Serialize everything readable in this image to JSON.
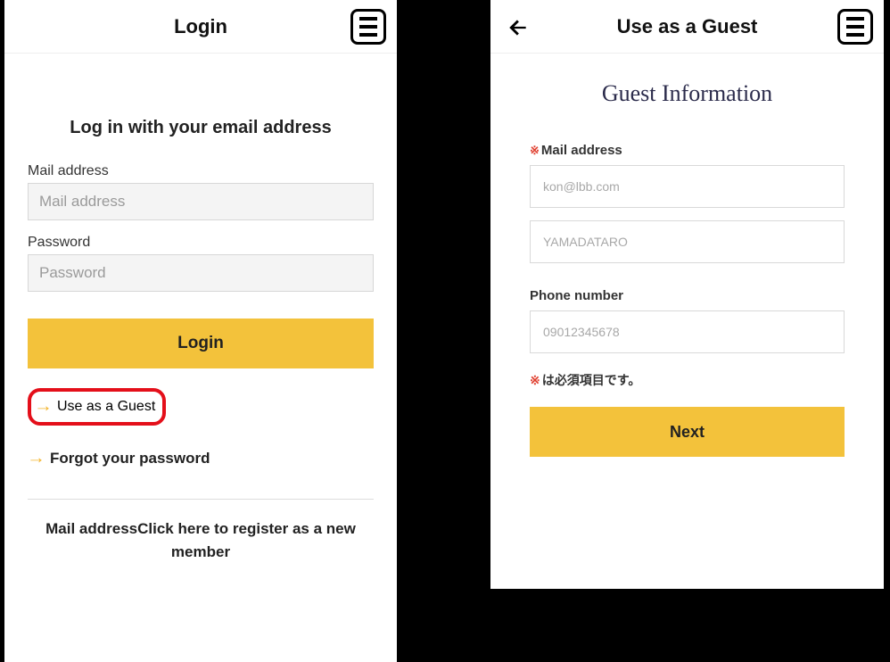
{
  "left": {
    "header_title": "Login",
    "heading": "Log in with your email address",
    "mail_label": "Mail address",
    "mail_placeholder": "Mail address",
    "password_label": "Password",
    "password_placeholder": "Password",
    "login_button": "Login",
    "guest_link": "Use as a Guest",
    "forgot_link": "Forgot your password",
    "register_text": "Mail addressClick here to register as a new member"
  },
  "right": {
    "header_title": "Use as a Guest",
    "subtitle": "Guest Information",
    "mail_label": "Mail address",
    "mail_placeholder": "kon@lbb.com",
    "name_placeholder": "YAMADATARO",
    "phone_label": "Phone number",
    "phone_placeholder": "09012345678",
    "required_note": "は必須項目です。",
    "required_mark": "※",
    "next_button": "Next"
  }
}
